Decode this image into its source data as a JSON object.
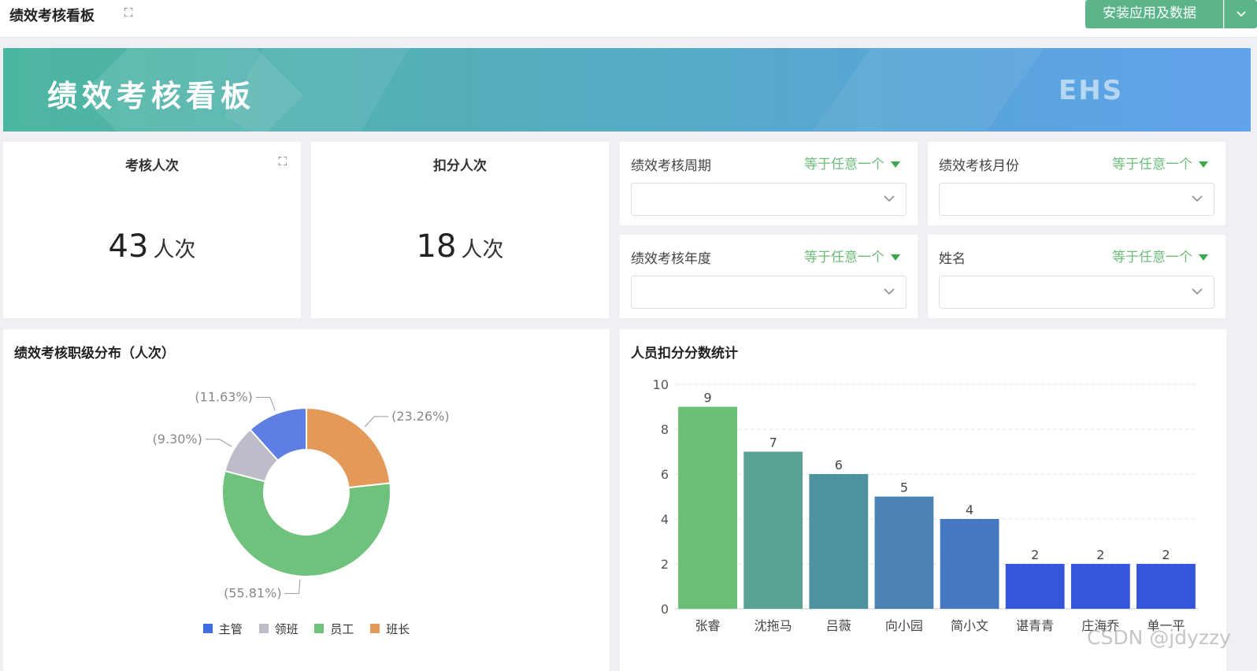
{
  "header": {
    "title": "绩效考核看板",
    "install_label": "安装应用及数据",
    "colors": {
      "accent": "#5cb589"
    }
  },
  "banner": {
    "title": "绩效考核看板",
    "logo_text": "EHS"
  },
  "kpis": [
    {
      "title": "考核人次",
      "value": "43",
      "unit": "人次"
    },
    {
      "title": "扣分人次",
      "value": "18",
      "unit": "人次"
    }
  ],
  "filters": [
    {
      "label": "绩效考核周期",
      "operator": "等于任意一个",
      "value": ""
    },
    {
      "label": "绩效考核月份",
      "operator": "等于任意一个",
      "value": ""
    },
    {
      "label": "绩效考核年度",
      "operator": "等于任意一个",
      "value": ""
    },
    {
      "label": "姓名",
      "operator": "等于任意一个",
      "value": ""
    }
  ],
  "charts": {
    "pie_title": "绩效考核职级分布（人次）",
    "bar_title": "人员扣分分数统计"
  },
  "chart_data": [
    {
      "type": "pie",
      "title": "绩效考核职级分布（人次）",
      "donut": true,
      "legend_position": "bottom",
      "slices": [
        {
          "name": "班长",
          "percent": 23.26,
          "label": "(23.26%)",
          "color": "#e39a58"
        },
        {
          "name": "员工",
          "percent": 55.81,
          "label": "(55.81%)",
          "color": "#6fc27c"
        },
        {
          "name": "领班",
          "percent": 9.3,
          "label": "(9.30%)",
          "color": "#bcbdc9"
        },
        {
          "name": "主管",
          "percent": 11.63,
          "label": "(11.63%)",
          "color": "#5f7ee3"
        }
      ],
      "legend": [
        {
          "name": "主管",
          "color": "#3f6ce0"
        },
        {
          "name": "领班",
          "color": "#bcbdc9"
        },
        {
          "name": "员工",
          "color": "#6fc27c"
        },
        {
          "name": "班长",
          "color": "#e39a58"
        }
      ]
    },
    {
      "type": "bar",
      "title": "人员扣分分数统计",
      "categories": [
        "张睿",
        "沈拖马",
        "吕薇",
        "向小园",
        "简小文",
        "谌青青",
        "庄海乔",
        "单一平"
      ],
      "values": [
        9,
        7,
        6,
        5,
        4,
        2,
        2,
        2
      ],
      "colors": [
        "#6abf74",
        "#5aa392",
        "#4f93a0",
        "#4a82b4",
        "#4577c2",
        "#3556db",
        "#3556db",
        "#3556db"
      ],
      "ylim": [
        0,
        10
      ],
      "yticks": [
        0,
        2,
        4,
        6,
        8,
        10
      ],
      "grid": true
    }
  ],
  "watermark": "CSDN @jdyzzy"
}
